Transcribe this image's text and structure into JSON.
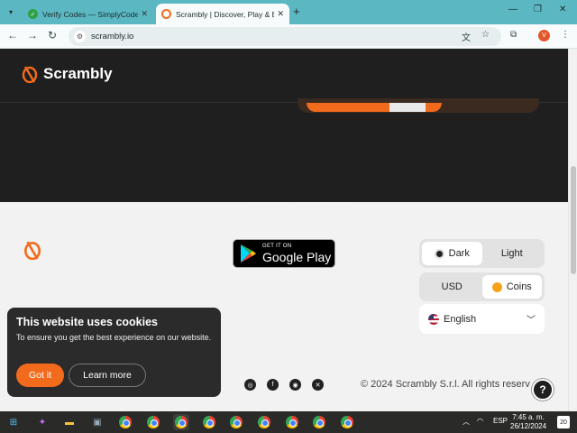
{
  "browser": {
    "tabs": [
      {
        "title": "Verify Codes — SimplyCodes",
        "active": false
      },
      {
        "title": "Scrambly | Discover, Play & Earn",
        "active": true
      }
    ],
    "url": "scrambly.io",
    "profile_initial": "V"
  },
  "site": {
    "brand": "Scrambly",
    "accent_color": "#f26b1d",
    "google_play": {
      "small": "GET IT ON",
      "big": "Google Play"
    },
    "theme_toggle": {
      "dark": "Dark",
      "light": "Light",
      "selected": "Dark"
    },
    "currency_toggle": {
      "usd": "USD",
      "coins": "Coins",
      "selected": "Coins"
    },
    "language": "English",
    "socials": [
      "instagram-icon",
      "facebook-icon",
      "discord-icon",
      "x-icon"
    ],
    "copyright": "© 2024 Scrambly S.r.l. All rights reserv",
    "help": "?"
  },
  "cookie": {
    "title": "This website uses cookies",
    "text": "To ensure you get the best experience on our website.",
    "accept": "Got it",
    "learn": "Learn more"
  },
  "taskbar": {
    "lang": "ESP",
    "time": "7:45 a. m.",
    "date": "26/12/2024",
    "notifications": "20"
  }
}
